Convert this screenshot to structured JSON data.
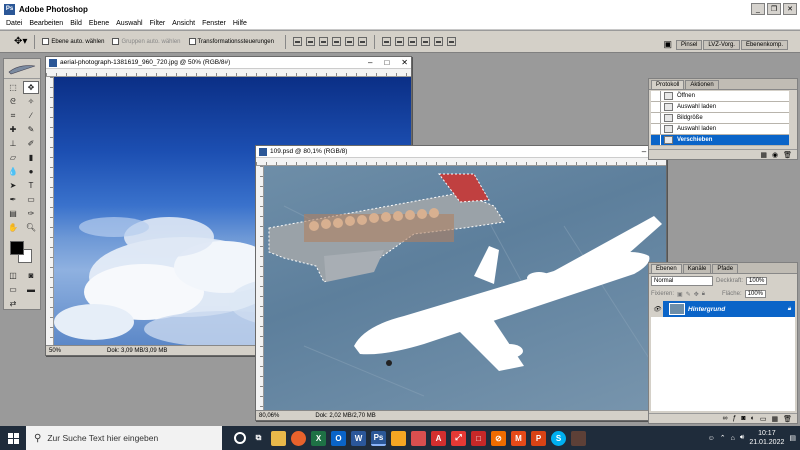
{
  "app": {
    "title": "Adobe Photoshop"
  },
  "menu": [
    "Datei",
    "Bearbeiten",
    "Bild",
    "Ebene",
    "Auswahl",
    "Filter",
    "Ansicht",
    "Fenster",
    "Hilfe"
  ],
  "options": {
    "auto_select_layer": "Ebene auto. wählen",
    "auto_select_groups": "Gruppen auto. wählen",
    "transform_controls": "Transformationssteuerungen"
  },
  "palette_well": [
    "Pinsel",
    "LVZ-Vorg.",
    "Ebenenkomp."
  ],
  "doc1": {
    "title": "aerial-photograph-1381619_960_720.jpg @ 50% (RGB/8#)",
    "zoom": "50%",
    "doc_size": "Dok: 3,09 MB/3,09 MB"
  },
  "doc2": {
    "title": "109.psd @ 80,1% (RGB/8)",
    "zoom": "80,06%",
    "doc_size": "Dok: 2,02 MB/2,70 MB"
  },
  "history": {
    "tabs": [
      "Protokoll",
      "Aktionen"
    ],
    "items": [
      "Öffnen",
      "Auswahl laden",
      "Bildgröße",
      "Auswahl laden",
      "Verschieben"
    ],
    "selected_index": 4
  },
  "layers": {
    "tabs": [
      "Ebenen",
      "Kanäle",
      "Pfade"
    ],
    "blend_mode": "Normal",
    "opacity_label": "Deckkraft:",
    "opacity_value": "100%",
    "lock_label": "Fixieren:",
    "fill_label": "Fläche:",
    "fill_value": "100%",
    "items": [
      {
        "name": "Hintergrund",
        "selected": true,
        "locked": true
      }
    ]
  },
  "taskbar": {
    "search_placeholder": "Zur Suche Text hier eingeben",
    "time": "10:17",
    "date": "21.01.2022"
  },
  "colors": {
    "accent": "#0a64c8",
    "taskbar": "#1f2c3b"
  }
}
